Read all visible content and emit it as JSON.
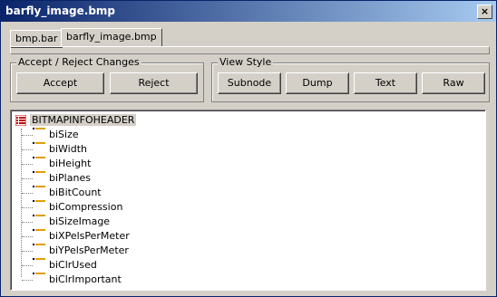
{
  "window": {
    "title": "barfly_image.bmp",
    "close_label": "×"
  },
  "tabs": [
    {
      "label": "bmp.bar"
    },
    {
      "label": "barfly_image.bmp"
    }
  ],
  "accept_reject": {
    "label": "Accept / Reject Changes",
    "accept": "Accept",
    "reject": "Reject"
  },
  "view_style": {
    "label": "View Style",
    "subnode": "Subnode",
    "dump": "Dump",
    "text": "Text",
    "raw": "Raw"
  },
  "tree": {
    "root": "BITMAPINFOHEADER",
    "nodes": [
      "biSize",
      "biWidth",
      "biHeight",
      "biPlanes",
      "biBitCount",
      "biCompression",
      "biSizeImage",
      "biXPelsPerMeter",
      "biYPelsPerMeter",
      "biClrUsed",
      "biClrImportant"
    ]
  }
}
